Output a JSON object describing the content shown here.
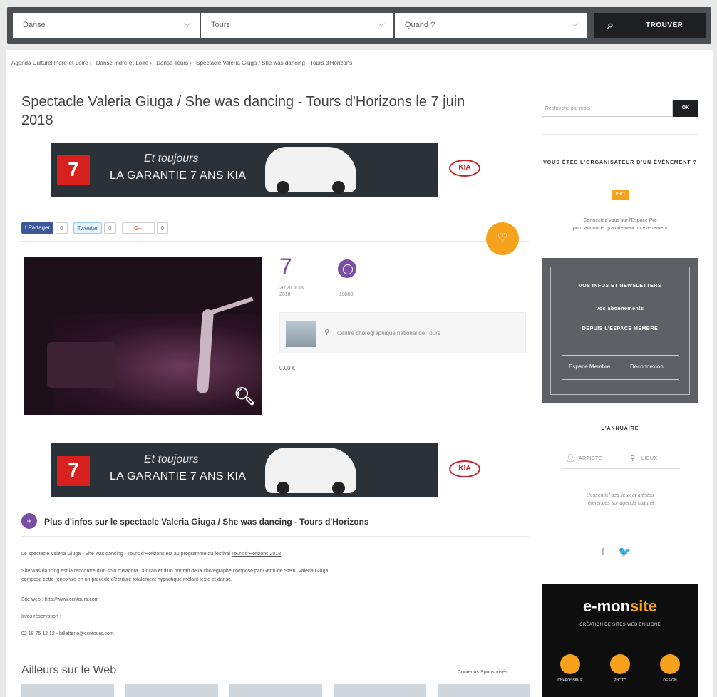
{
  "search": {
    "category": "Danse",
    "city": "Tours",
    "when": "Quand ?",
    "button_label": "TROUVER",
    "chevron": "chevron-down-icon"
  },
  "breadcrumb": [
    "Agenda Culturel Indre-et-Loire ›",
    "Danse Indre-et-Loire ›",
    "Danse Tours ›",
    "Spectacle Valeria Giuga / She was dancing - Tours d'Horizons"
  ],
  "event": {
    "title": "Spectacle Valeria Giuga / She was dancing - Tours d'Horizons le 7 juin 2018",
    "day": "7",
    "date_sub": "20:20 JUIN 2018",
    "time": "19h00",
    "venue": "Centre chorégraphique national de Tours",
    "price": "0.00 €"
  },
  "ads": {
    "tagline": "Et toujours",
    "headline": "LA GARANTIE 7 ANS KIA",
    "badge": "7",
    "brand": "KIA"
  },
  "share": {
    "facebook": "f Partager",
    "facebook_count": "0",
    "twitter": "Tweeter",
    "twitter_count": "0",
    "gplus": "G+",
    "gplus_count": "0"
  },
  "more": {
    "title": "Plus d'infos sur le spectacle Valeria Giuga / She was dancing - Tours d'Horizons",
    "p1_text": "Le spectacle Valeria Giuga - She was dancing - Tours d'Horizons est au programme du festival",
    "p1_link": "Tours d'Horizons 2018",
    "p2": "She was dancing est la rencontre d'un solo d'Isadora Duncan et d'un portrait de la chorégraphe composé par Gertrude Stein. Valeria Giuga",
    "p2b": "compose cette rencontre en un procédé d'écriture totalement hypnotique mêlant texte et danse.",
    "web_label": "Site web :",
    "web_link": "http://www.ccntours.com",
    "resa_label": "Infos réservation :",
    "phone": "02 18 75 12 12 -",
    "email": "billetterie@ccntours.com",
    "elsewhere": "Ailleurs sur le Web",
    "sponsored": "Contenus Sponsorisés"
  },
  "sidebar": {
    "search_placeholder": "Recherche par mots",
    "ok": "OK",
    "org_title": "VOUS ÊTES L'ORGANISATEUR D'UN ÉVÈNEMENT ?",
    "org_badge": "PRO",
    "org_text_1": "Connectez-vous sur l'Espace Pro",
    "org_text_2": "pour annoncer gratuitement un évènement",
    "promo_1": "VOS INFOS ET NEWSLETTERS",
    "promo_2": "vos abonnements",
    "promo_3": "DEPUIS L'ESPACE MEMBRE",
    "promo_signup": "Espace Membre",
    "promo_logout": "Déconnexion",
    "annu_title": "L'ANNUAIRE",
    "annu_artists": "ARTISTE",
    "annu_places": "LIEUX",
    "annu_text_1": "L'essentiel des lieux et artistes",
    "annu_text_2": "référencés sur agenda culturel",
    "social_fb": "f",
    "social_tw": "🐦",
    "emon_logo_a": "e-mon",
    "emon_logo_b": "site",
    "emon_sub": "CRÉATION DE SITES WEB EN LIGNE",
    "emon_c1": "CHAPOSSIBLE",
    "emon_c2": "PHOTO",
    "emon_c3": "DESIGN"
  }
}
